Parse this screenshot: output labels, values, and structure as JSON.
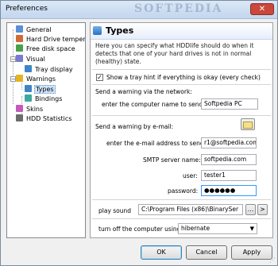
{
  "window": {
    "title": "Preferences",
    "watermark": "SOFTPEDIA",
    "close_label": "✕"
  },
  "tree": {
    "items": [
      {
        "label": "General",
        "icon": "general-icon",
        "color": "#5b8fd6"
      },
      {
        "label": "Hard Drive temper",
        "icon": "thermometer-icon",
        "color": "#d06a38"
      },
      {
        "label": "Free disk space",
        "icon": "disk-icon",
        "color": "#4aa04a"
      },
      {
        "label": "Visual",
        "icon": "visual-icon",
        "color": "#7a7ad0"
      },
      {
        "label": "Tray display",
        "icon": "tray-icon",
        "color": "#3d85c6"
      },
      {
        "label": "Warnings",
        "icon": "warning-icon",
        "color": "#e2b422"
      },
      {
        "label": "Types",
        "icon": "types-icon",
        "color": "#3d85c6"
      },
      {
        "label": "Bindings",
        "icon": "bindings-icon",
        "color": "#3ea8a0"
      },
      {
        "label": "Skins",
        "icon": "skins-icon",
        "color": "#c25cb8"
      },
      {
        "label": "HDD Statistics",
        "icon": "statistics-icon",
        "color": "#6c6c6c"
      }
    ]
  },
  "panel": {
    "title": "Types",
    "intro": "Here you can specify what HDDlife should do when it detects that one of your hard drives is not in normal (healthy) state.",
    "tray_hint_label": "Show a tray hint if everything is okay (every check)",
    "tray_hint_checked": "✓",
    "network_heading": "Send a warning via the network:",
    "computer_label": "enter the computer name to send",
    "computer_value": "Softpedia PC",
    "email_heading": "Send a warning by e-mail:",
    "email_label": "enter the e-mail address to send",
    "email_value": "r1@softpedia.com",
    "smtp_label": "SMTP server name:",
    "smtp_value": "softpedia.com",
    "user_label": "user:",
    "user_value": "tester1",
    "password_label": "password:",
    "password_value": "●●●●●●",
    "sound_label": "play sound",
    "sound_value": "C:\\Program Files (x86)\\BinarySer",
    "browse_label": "...",
    "play_label": ">",
    "shutdown_label": "turn off the computer using:",
    "shutdown_value": "hibernate"
  },
  "buttons": {
    "ok": "OK",
    "cancel": "Cancel",
    "apply": "Apply"
  }
}
